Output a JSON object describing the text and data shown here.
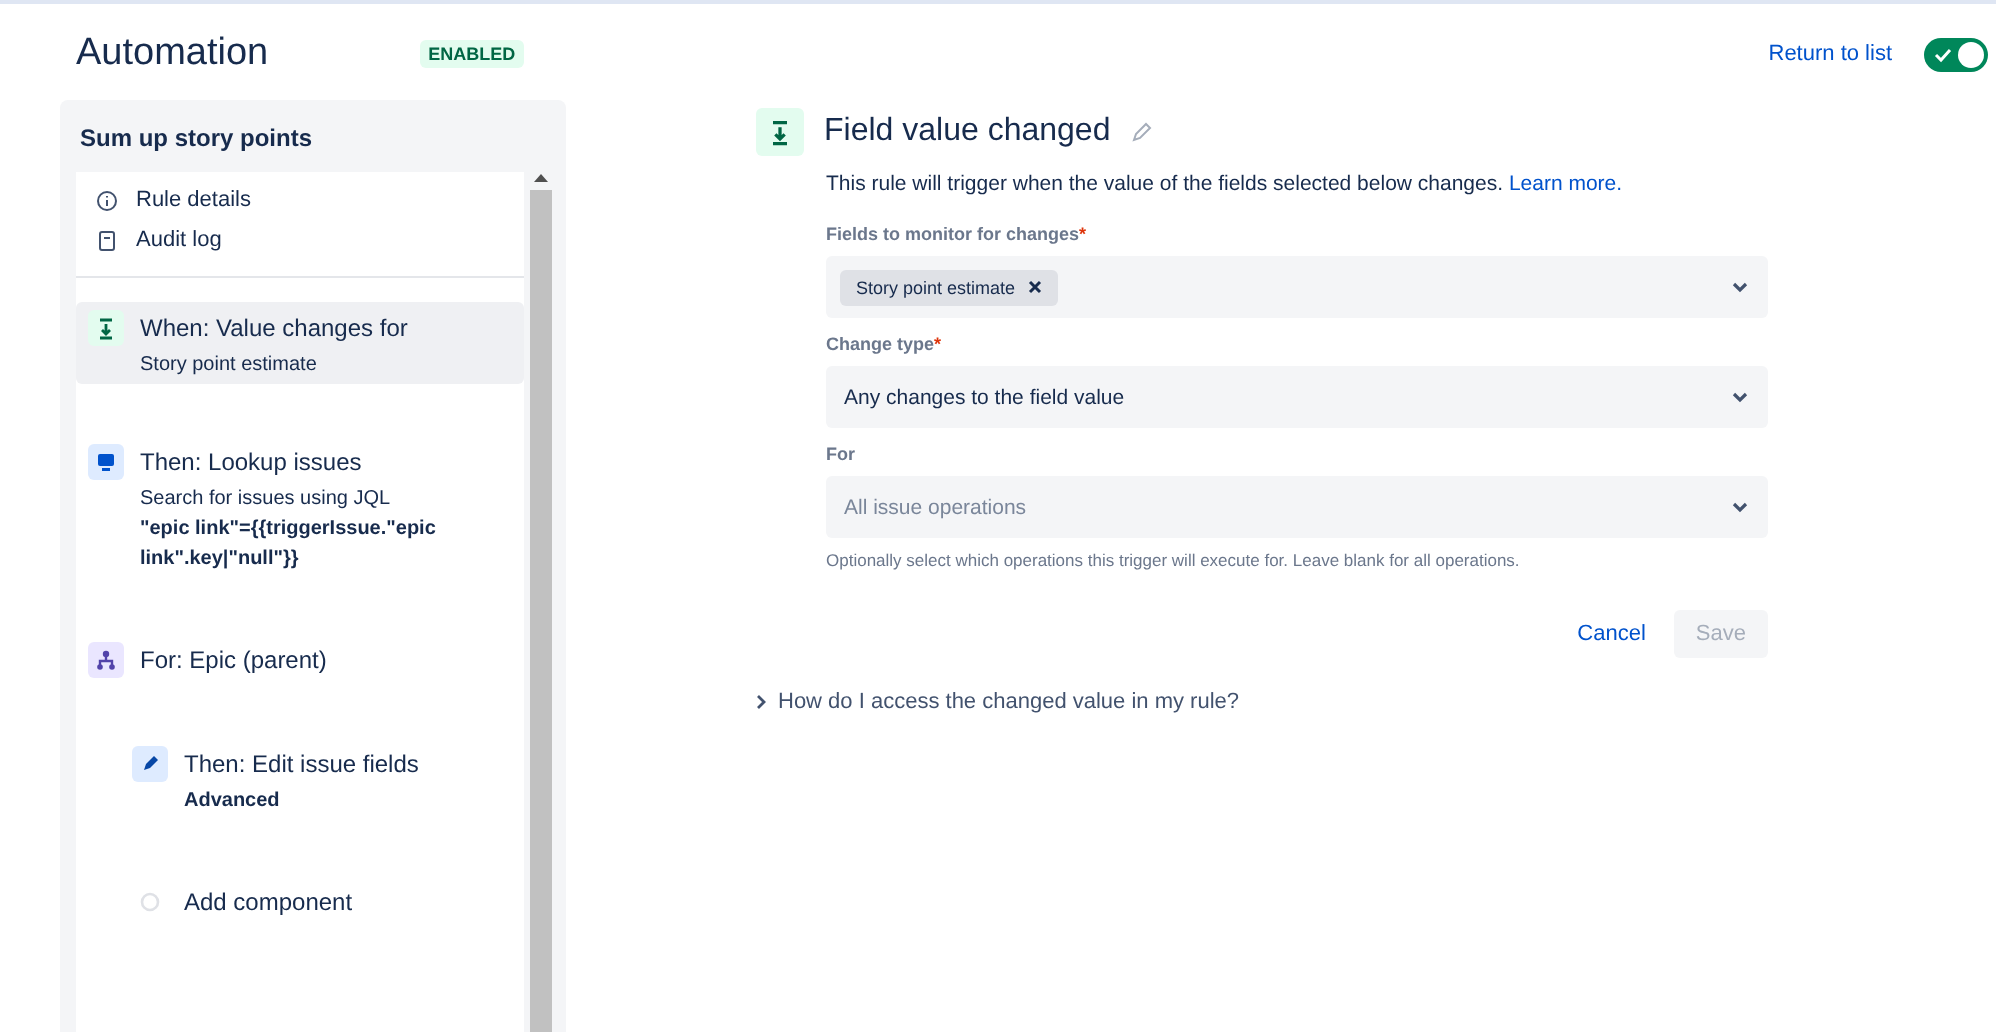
{
  "header": {
    "title": "Automation",
    "status": "ENABLED",
    "return_link": "Return to list",
    "toggle_on": true
  },
  "sidebar": {
    "title": "Sum up story points",
    "nav": [
      {
        "kind": "info",
        "label": "Rule details"
      },
      {
        "kind": "log",
        "label": "Audit log"
      }
    ],
    "steps": [
      {
        "kind": "trigger",
        "title": "When: Value changes for",
        "detail": "Story point estimate",
        "selected": true
      },
      {
        "kind": "lookup",
        "title": "Then: Lookup issues",
        "detail": "Search for issues using JQL",
        "code": "\"epic link\"={{triggerIssue.\"epic link\".key|\"null\"}}",
        "selected": false
      },
      {
        "kind": "branch",
        "title": "For: Epic (parent)",
        "selected": false,
        "children": [
          {
            "kind": "edit",
            "title": "Then: Edit issue fields",
            "code": "Advanced",
            "selected": false
          },
          {
            "kind": "add",
            "title": "Add component",
            "selected": false
          }
        ]
      }
    ]
  },
  "detail": {
    "title": "Field value changed",
    "description": "This rule will trigger when the value of the fields selected below changes.",
    "learn_more": "Learn more.",
    "fields": [
      {
        "label": "Fields to monitor for changes",
        "required_mark": "*",
        "tags": [
          "Story point estimate"
        ]
      },
      {
        "label": "Change type",
        "required_mark": "*",
        "value": "Any changes to the field value"
      },
      {
        "label": "For",
        "placeholder": "All issue operations",
        "help": "Optionally select which operations this trigger will execute for. Leave blank for all operations."
      }
    ],
    "cancel": "Cancel",
    "save": "Save",
    "save_disabled": true,
    "faq": "How do I access the changed value in my rule?"
  }
}
